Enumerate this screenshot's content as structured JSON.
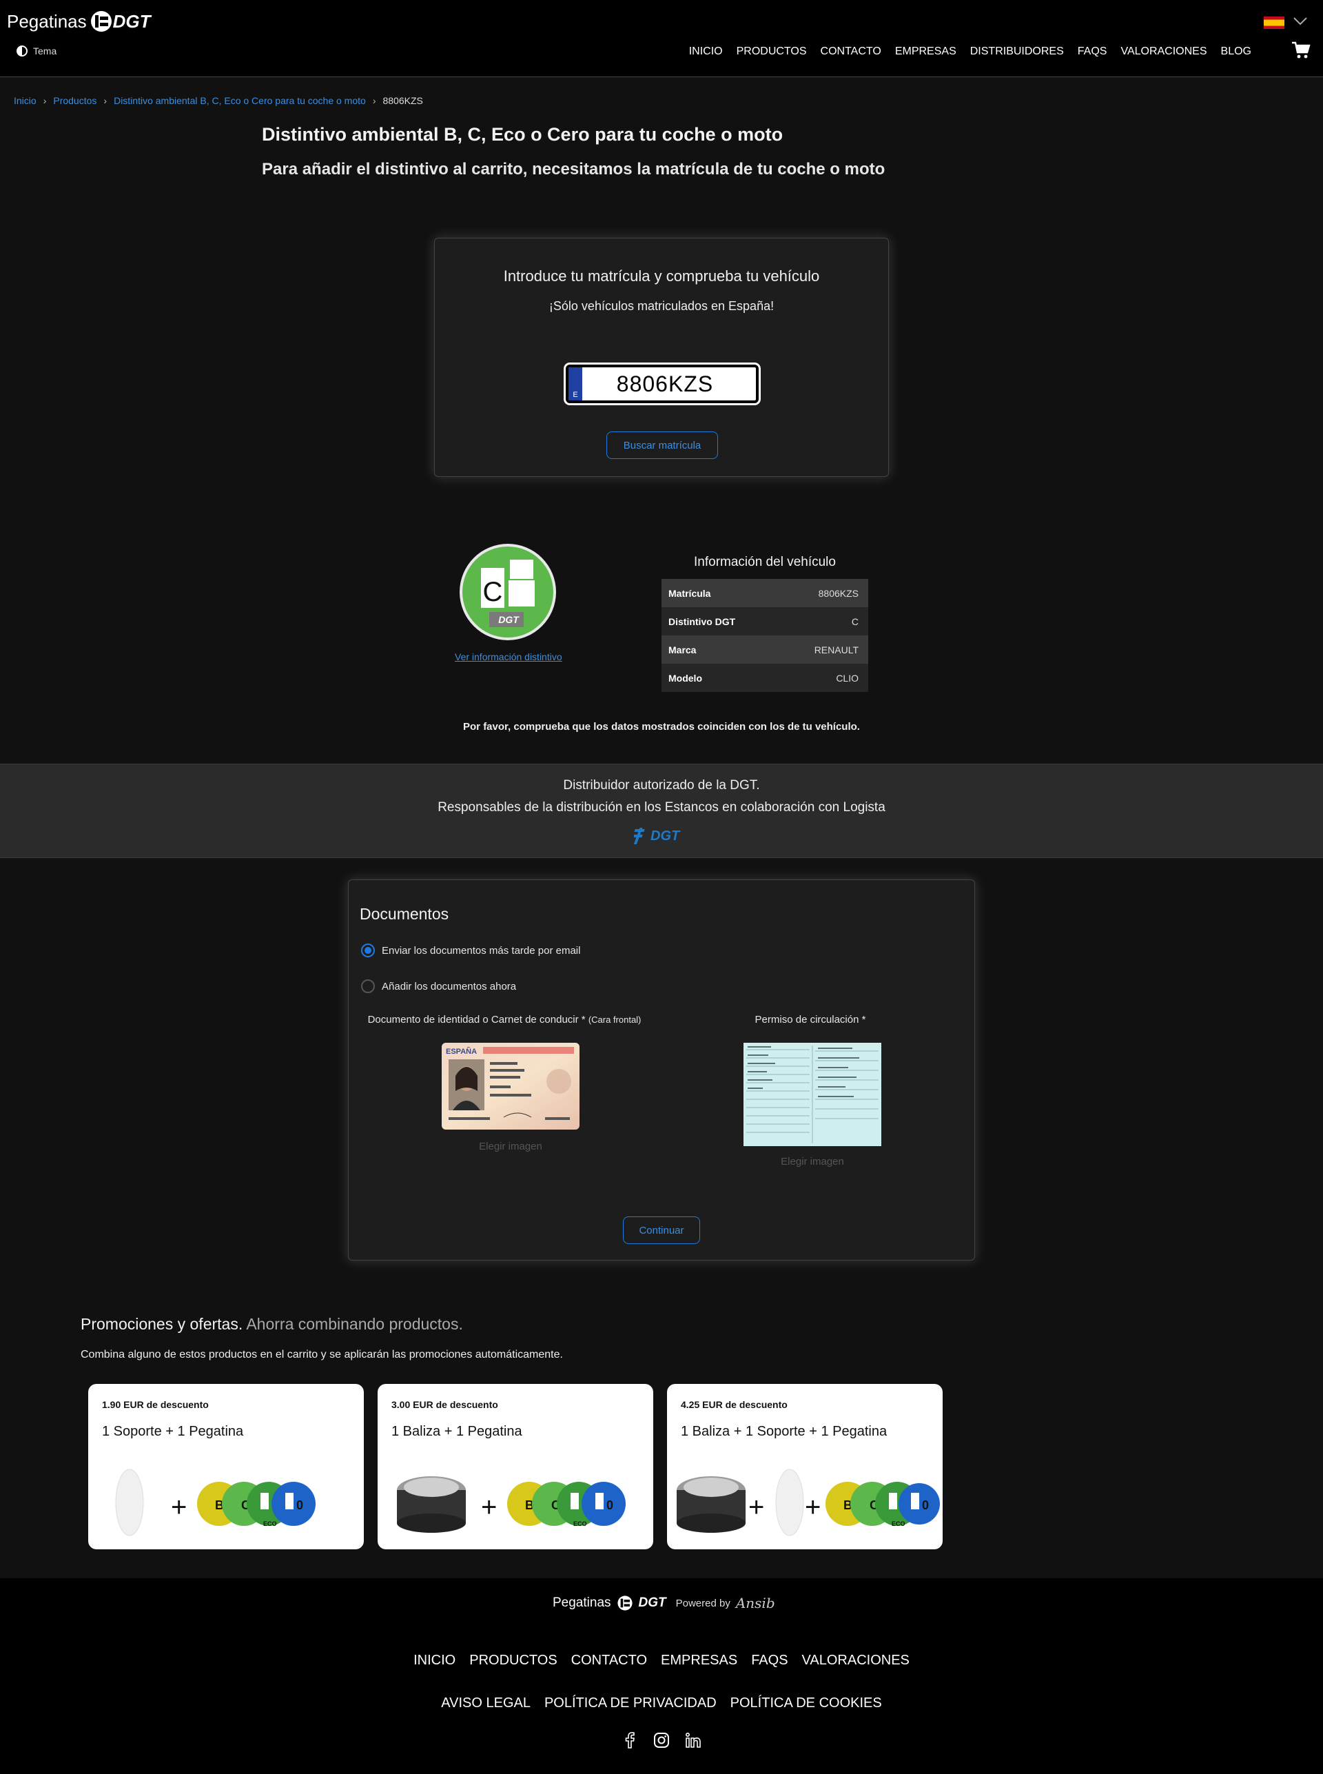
{
  "header": {
    "logo_word": "Pegatinas",
    "logo_dgt": "DGT",
    "theme_label": "Tema",
    "nav": [
      "INICIO",
      "PRODUCTOS",
      "CONTACTO",
      "EMPRESAS",
      "DISTRIBUIDORES",
      "FAQS",
      "VALORACIONES",
      "BLOG"
    ]
  },
  "breadcrumb": [
    "Inicio",
    "Productos",
    "Distintivo ambiental B, C, Eco o Cero para tu coche o moto",
    "8806KZS"
  ],
  "page": {
    "title": "Distintivo ambiental B, C, Eco o Cero para tu coche o moto",
    "subtitle": "Para añadir el distintivo al carrito, necesitamos la matrícula de tu coche o moto"
  },
  "plate_card": {
    "title": "Introduce tu matrícula y comprueba tu vehículo",
    "subtitle": "¡Sólo vehículos matriculados en España!",
    "plate_value": "8806KZS",
    "plate_country": "E",
    "button": "Buscar matrícula"
  },
  "vehicle": {
    "sticker_letter": "C",
    "sticker_dgt": "DGT",
    "link": "Ver información distintivo",
    "title": "Información del vehículo",
    "rows": [
      {
        "k": "Matrícula",
        "v": "8806KZS"
      },
      {
        "k": "Distintivo DGT",
        "v": "C"
      },
      {
        "k": "Marca",
        "v": "RENAULT"
      },
      {
        "k": "Modelo",
        "v": "CLIO"
      }
    ],
    "note": "Por favor, comprueba que los datos mostrados coinciden con los de tu vehículo."
  },
  "banner": {
    "line1": "Distribuidor autorizado de la DGT.",
    "line2": "Responsables de la distribución en los Estancos en colaboración con Logista",
    "logo_text": "DGT"
  },
  "documents": {
    "title": "Documentos",
    "option_later": "Enviar los documentos más tarde por email",
    "option_now": "Añadir los documentos ahora",
    "id_label": "Documento de identidad o Carnet de conducir *",
    "id_label_small": "(Cara frontal)",
    "permit_label": "Permiso de circulación *",
    "choose_image": "Elegir imagen",
    "id_card_country": "ESPAÑA",
    "continue": "Continuar"
  },
  "promos": {
    "title": "Promociones y ofertas.",
    "title_dim": "Ahorra combinando productos.",
    "subtitle": "Combina alguno de estos productos en el carrito y se aplicarán las promociones automáticamente.",
    "items": [
      {
        "discount": "1.90 EUR de descuento",
        "name": "1 Soporte + 1 Pegatina"
      },
      {
        "discount": "3.00 EUR de descuento",
        "name": "1 Baliza + 1 Pegatina"
      },
      {
        "discount": "4.25 EUR de descuento",
        "name": "1 Baliza + 1 Soporte + 1 Pegatina"
      }
    ],
    "plus": "+",
    "sticker_letters": [
      "B",
      "C",
      "ECO",
      "0"
    ]
  },
  "footer": {
    "logo_word": "Pegatinas",
    "logo_dgt": "DGT",
    "powered": "Powered by",
    "ansib": "Ansib",
    "nav1": [
      "INICIO",
      "PRODUCTOS",
      "CONTACTO",
      "EMPRESAS",
      "FAQS",
      "VALORACIONES"
    ],
    "nav2": [
      "AVISO LEGAL",
      "POLÍTICA DE PRIVACIDAD",
      "POLÍTICA DE COOKIES"
    ],
    "social": [
      "facebook-icon",
      "instagram-icon",
      "linkedin-icon"
    ]
  },
  "colors": {
    "accent": "#1f7ae0",
    "background": "#111111",
    "header": "#000000",
    "sticker_green": "#5cb84a",
    "sticker_yellow": "#d8c81c",
    "sticker_blue": "#1e64c8"
  }
}
